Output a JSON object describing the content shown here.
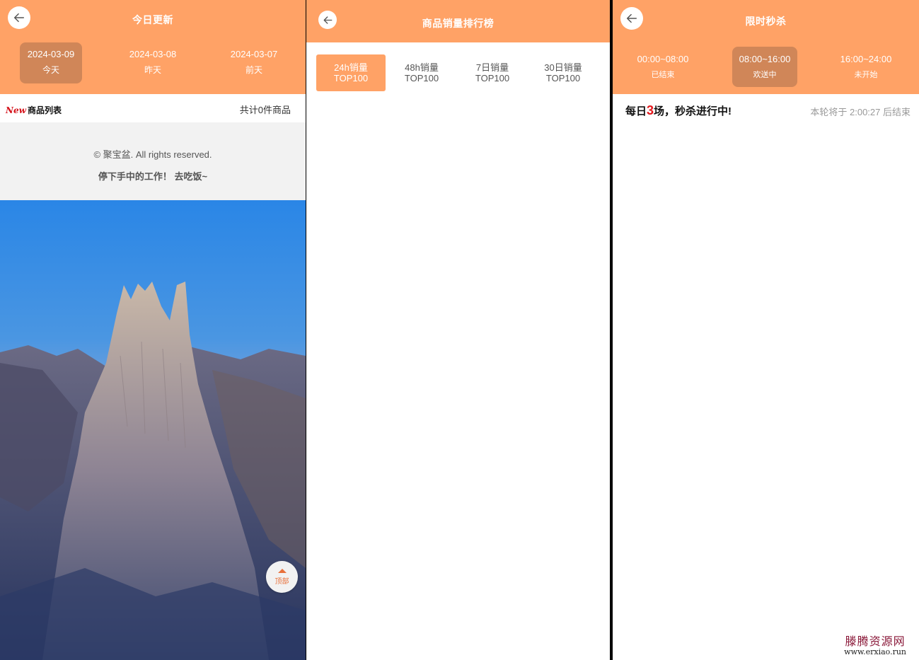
{
  "colors": {
    "accent": "#FFA266",
    "active_tab": "#D08658",
    "highlight": "#E4171B"
  },
  "panel1": {
    "title": "今日更新",
    "back_icon": "arrow-left-icon",
    "dates": [
      {
        "date": "2024-03-09",
        "label": "今天",
        "active": true
      },
      {
        "date": "2024-03-08",
        "label": "昨天",
        "active": false
      },
      {
        "date": "2024-03-07",
        "label": "前天",
        "active": false
      }
    ],
    "list": {
      "new_mark": "New",
      "title": "商品列表",
      "count": "共计0件商品"
    },
    "footer": {
      "copyright": "© 聚宝盆. All rights reserved.",
      "slogan": "停下手中的工作！ 去吃饭~"
    },
    "top_button": "顶部"
  },
  "panel2": {
    "title": "商品销量排行榜",
    "tabs": [
      {
        "line1": "24h销量",
        "line2": "TOP100",
        "active": true
      },
      {
        "line1": "48h销量",
        "line2": "TOP100",
        "active": false
      },
      {
        "line1": "7日销量",
        "line2": "TOP100",
        "active": false
      },
      {
        "line1": "30日销量",
        "line2": "TOP100",
        "active": false
      }
    ]
  },
  "panel3": {
    "title": "限时秒杀",
    "slots": [
      {
        "time": "00:00~08:00",
        "status": "已结束",
        "active": false
      },
      {
        "time": "08:00~16:00",
        "status": "欢送中",
        "active": true
      },
      {
        "time": "16:00~24:00",
        "status": "未开始",
        "active": false
      }
    ],
    "banner": {
      "prefix": "每日",
      "count": "3",
      "suffix": "场，秒杀进行中!"
    },
    "countdown": "本轮将于 2:00:27 后结束",
    "watermark": {
      "name": "滕腾资源网",
      "url": "www.erxiao.run"
    }
  }
}
